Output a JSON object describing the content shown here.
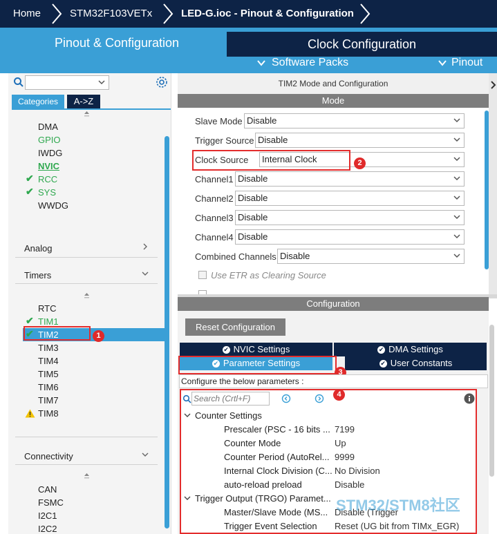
{
  "breadcrumb": {
    "home": "Home",
    "device": "STM32F103VETx",
    "file": "LED-G.ioc - Pinout & Configuration"
  },
  "tabs": {
    "pinout": "Pinout & Configuration",
    "clock": "Clock Configuration",
    "software_packs": "Software Packs",
    "pinout_menu": "Pinout"
  },
  "left": {
    "categories_tab": "Categories",
    "az_tab": "A->Z",
    "system_items": [
      "DMA",
      "GPIO",
      "IWDG",
      "NVIC",
      "RCC",
      "SYS",
      "WWDG"
    ],
    "analog": "Analog",
    "timers": "Timers",
    "timer_items": [
      "RTC",
      "TIM1",
      "TIM2",
      "TIM3",
      "TIM4",
      "TIM5",
      "TIM6",
      "TIM7",
      "TIM8"
    ],
    "connectivity": "Connectivity",
    "conn_items": [
      "CAN",
      "FSMC",
      "I2C1",
      "I2C2"
    ]
  },
  "mode": {
    "title": "TIM2 Mode and Configuration",
    "header": "Mode",
    "slave_mode_label": "Slave Mode",
    "slave_mode_value": "Disable",
    "trigger_source_label": "Trigger Source",
    "trigger_source_value": "Disable",
    "clock_source_label": "Clock Source",
    "clock_source_value": "Internal Clock",
    "channel1_label": "Channel1",
    "channel1_value": "Disable",
    "channel2_label": "Channel2",
    "channel2_value": "Disable",
    "channel3_label": "Channel3",
    "channel3_value": "Disable",
    "channel4_label": "Channel4",
    "channel4_value": "Disable",
    "combined_label": "Combined Channels",
    "combined_value": "Disable",
    "etr_label": "Use ETR as Clearing Source"
  },
  "config": {
    "header": "Configuration",
    "reset_button": "Reset Configuration",
    "nvic_tab": "NVIC Settings",
    "dma_tab": "DMA Settings",
    "param_tab": "Parameter Settings",
    "user_tab": "User Constants",
    "hint": "Configure the below parameters :",
    "search_placeholder": "Search (Crtl+F)",
    "counter_group": "Counter Settings",
    "params": [
      {
        "name": "Prescaler (PSC - 16 bits ...",
        "value": "7199"
      },
      {
        "name": "Counter Mode",
        "value": "Up"
      },
      {
        "name": "Counter Period (AutoRel...",
        "value": "9999"
      },
      {
        "name": "Internal Clock Division (C...",
        "value": "No Division"
      },
      {
        "name": "auto-reload preload",
        "value": "Disable"
      }
    ],
    "trgo_group": "Trigger Output (TRGO) Paramet...",
    "trgo_params": [
      {
        "name": "Master/Slave Mode (MS...",
        "value": "Disable (Trigger"
      },
      {
        "name": "Trigger Event Selection",
        "value": "Reset (UG bit from TIMx_EGR)"
      }
    ]
  },
  "badges": [
    "1",
    "2",
    "3",
    "4"
  ],
  "watermark": "STM32/STM8社区",
  "colors": {
    "navy": "#0d2346",
    "accent_blue": "#3a9fd6",
    "check_green": "#2fa84f",
    "warning_yellow": "#f3c300",
    "annotation_red": "#e32c2c"
  }
}
